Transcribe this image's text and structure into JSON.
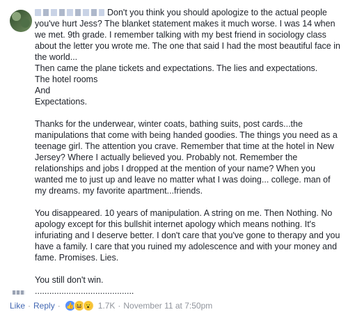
{
  "comment": {
    "paragraphs": [
      "Don't you think you should apologize to the actual people you've hurt Jess? The blanket statement makes it much worse. I was 14 when we met. 9th grade. I remember talking with my best friend in sociology class about the letter you wrote me. The one that said I had the most beautiful face in the world...\nThen came the plane tickets and expectations. The lies and expectations.\nThe hotel rooms\nAnd\nExpectations.",
      "Thanks for the underwear, winter coats, bathing suits, post cards...the manipulations that come with being handed goodies. The things you need as a teenage girl. The attention you crave. Remember that time at the hotel in New Jersey? Where I actually believed you. Probably not. Remember the relationships and jobs I dropped at the mention of your name? When you wanted me to just up and leave no matter what I was doing... college. man of my dreams. my favorite apartment...friends.",
      "You disappeared. 10 years of manipulation. A string on me. Then Nothing. No apology except for this bullshit internet apology which means nothing. It's infuriating and I deserve better. I don't care that you've gone to therapy and you have a family. I care that you ruined my adolescence and with your money and fame. Promises. Lies.",
      "You still don't win."
    ],
    "dots": "........................................."
  },
  "actions": {
    "like_label": "Like",
    "separator": "·",
    "reply_label": "Reply",
    "reaction_count": "1.7K",
    "timestamp": "November 11 at 7:50pm",
    "reactions": [
      "like-icon",
      "haha-icon",
      "wow-icon"
    ]
  },
  "colors": {
    "link": "#4267b2",
    "meta": "#90949c",
    "text": "#1d2129"
  }
}
